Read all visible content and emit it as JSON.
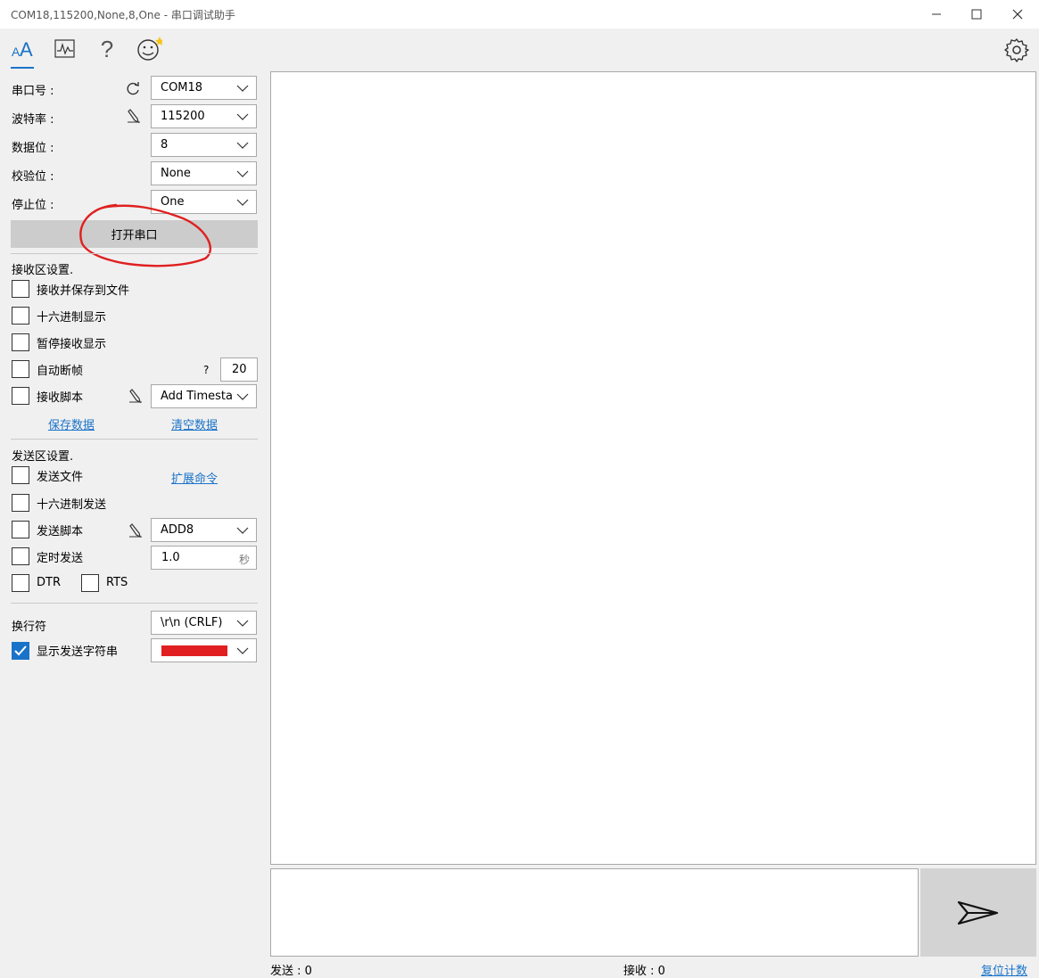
{
  "window": {
    "title": "COM18,115200,None,8,One - 串口调试助手",
    "minimize_glyph": "—",
    "maximize_glyph": "☐",
    "close_glyph": "✕"
  },
  "toolbar": {
    "icons": [
      "font-icon",
      "waveform-icon",
      "help-icon",
      "smiley-icon",
      "settings-gear-icon"
    ],
    "help_glyph": "?",
    "accent_color": "#1a73c9"
  },
  "serial": {
    "port_label": "串口号 :",
    "port_value": "COM18",
    "baud_label": "波特率 :",
    "baud_value": "115200",
    "databits_label": "数据位 :",
    "databits_value": "8",
    "parity_label": "校验位 :",
    "parity_value": "None",
    "stopbits_label": "停止位 :",
    "stopbits_value": "One",
    "open_button": "打开串口"
  },
  "receive": {
    "section_title": "接收区设置.",
    "save_to_file": "接收并保存到文件",
    "hex_display": "十六进制显示",
    "pause_display": "暂停接收显示",
    "auto_frame": "自动断帧",
    "auto_frame_help": "?",
    "auto_frame_value": "20",
    "script": "接收脚本",
    "script_value": "Add Timesta",
    "save_data": "保存数据",
    "clear_data": "清空数据"
  },
  "send": {
    "section_title": "发送区设置.",
    "send_file": "发送文件",
    "extend_cmd": "扩展命令",
    "hex_send": "十六进制发送",
    "script": "发送脚本",
    "script_value": "ADD8",
    "timed_send": "定时发送",
    "timed_value": "1.0",
    "timed_unit": "秒",
    "dtr": "DTR",
    "rts": "RTS"
  },
  "line": {
    "newline_label": "换行符",
    "newline_value": "\\r\\n (CRLF)",
    "show_sent": "显示发送字符串",
    "show_sent_checked": true,
    "color_value": "#e02020"
  },
  "status": {
    "sent": "发送 : 0",
    "received": "接收 : 0",
    "reset": "复位计数"
  }
}
